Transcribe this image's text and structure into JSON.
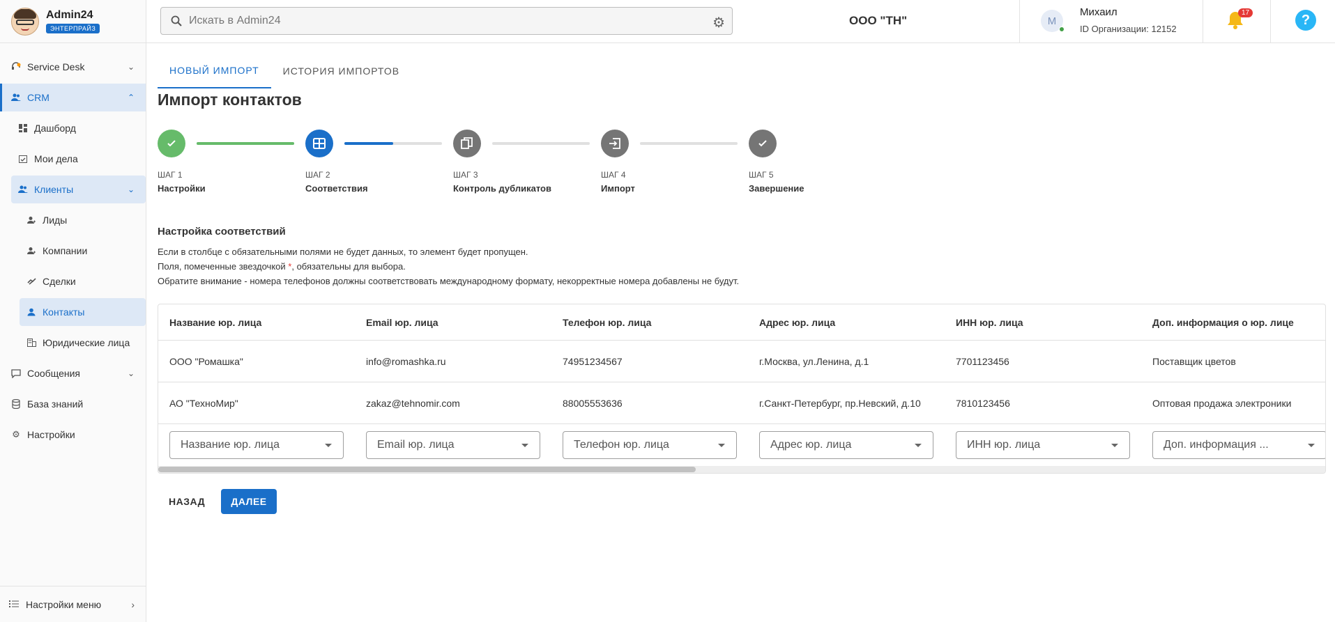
{
  "brand": {
    "name": "Admin24",
    "badge": "ЭНТЕРПРАЙЗ"
  },
  "sidebar": {
    "items": [
      {
        "label": "Service Desk",
        "icon": "headset-icon",
        "chevron": "⌄"
      },
      {
        "label": "CRM",
        "icon": "people-icon",
        "chevron": "⌃"
      },
      {
        "label": "Дашборд",
        "icon": "dashboard-icon"
      },
      {
        "label": "Мои дела",
        "icon": "calendar-check-icon"
      },
      {
        "label": "Клиенты",
        "icon": "group-icon",
        "chevron": "⌄"
      },
      {
        "label": "Лиды",
        "icon": "person-add-icon"
      },
      {
        "label": "Компании",
        "icon": "person-add-icon"
      },
      {
        "label": "Сделки",
        "icon": "handshake-icon"
      },
      {
        "label": "Контакты",
        "icon": "person-icon"
      },
      {
        "label": "Юридические лица",
        "icon": "building-icon"
      },
      {
        "label": "Сообщения",
        "icon": "chat-icon",
        "chevron": "⌄"
      },
      {
        "label": "База знаний",
        "icon": "database-icon"
      },
      {
        "label": "Настройки",
        "icon": "gear-icon"
      }
    ],
    "bottom_label": "Настройки меню"
  },
  "header": {
    "search_placeholder": "Искать в Admin24",
    "org_title": "ООО \"ТН\"",
    "user_initial": "М",
    "user_name": "Михаил",
    "user_org": "ID Организации: 12152",
    "notifications_count": "17",
    "help_label": "?"
  },
  "tabs": [
    {
      "label": "НОВЫЙ ИМПОРТ",
      "active": true
    },
    {
      "label": "ИСТОРИЯ ИМПОРТОВ",
      "active": false
    }
  ],
  "page_title": "Импорт контактов",
  "steps": [
    {
      "num": "ШАГ 1",
      "name": "Настройки",
      "state": "done",
      "color": "#66bb6a",
      "icon": "check-icon",
      "line_progress": 1.0,
      "line_color": "#66bb6a"
    },
    {
      "num": "ШАГ 2",
      "name": "Соответствия",
      "state": "active",
      "color": "#1a6fc9",
      "icon": "table-icon",
      "line_progress": 0.5,
      "line_color": "#1a6fc9"
    },
    {
      "num": "ШАГ 3",
      "name": "Контроль дубликатов",
      "state": "pending",
      "color": "#757575",
      "icon": "copy-icon",
      "line_progress": 0,
      "line_color": "#e0e0e0"
    },
    {
      "num": "ШАГ 4",
      "name": "Импорт",
      "state": "pending",
      "color": "#757575",
      "icon": "import-icon",
      "line_progress": 0,
      "line_color": "#e0e0e0"
    },
    {
      "num": "ШАГ 5",
      "name": "Завершение",
      "state": "pending",
      "color": "#757575",
      "icon": "check-icon"
    }
  ],
  "mapping": {
    "title": "Настройка соответствий",
    "desc_1": "Если в столбце с обязательными полями не будет данных, то элемент будет пропущен.",
    "desc_2_before": "Поля, помеченные звездочкой ",
    "desc_2_star": "*",
    "desc_2_after": ", обязательны для выбора.",
    "desc_3": "Обратите внимание - номера телефонов должны соответствовать международному формату, некорректные номера добавлены не будут."
  },
  "table": {
    "headers": [
      "Название юр. лица",
      "Email юр. лица",
      "Телефон юр. лица",
      "Адрес юр. лица",
      "ИНН юр. лица",
      "Доп. информация о юр. лице"
    ],
    "rows": [
      [
        "ООО \"Ромашка\"",
        "info@romashka.ru",
        "74951234567",
        "г.Москва, ул.Ленина, д.1",
        "7701123456",
        "Поставщик цветов"
      ],
      [
        "АО \"ТехноМир\"",
        "zakaz@tehnomir.com",
        "88005553636",
        "г.Санкт-Петербург, пр.Невский, д.10",
        "7810123456",
        "Оптовая продажа электроники"
      ]
    ],
    "selects": [
      "Название юр. лица",
      "Email юр. лица",
      "Телефон юр. лица",
      "Адрес юр. лица",
      "ИНН юр. лица",
      "Доп. информация ..."
    ],
    "scroll_fraction": 0.46
  },
  "buttons": {
    "back": "НАЗАД",
    "next": "ДАЛЕЕ"
  }
}
